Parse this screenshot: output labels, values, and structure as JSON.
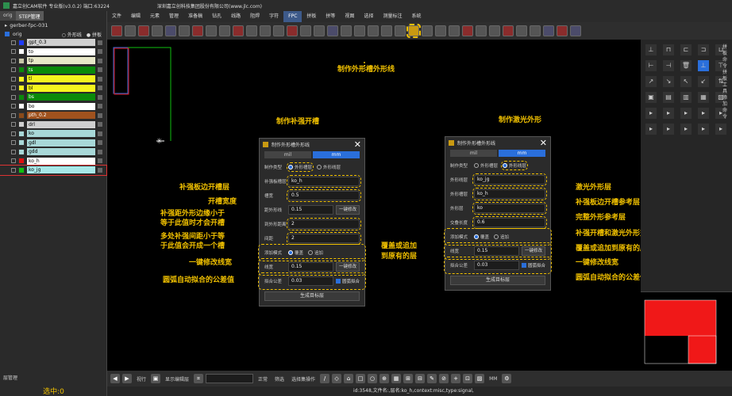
{
  "titlebar": {
    "app_title": "嘉立创CAM软件 专业版(v3.0.2) 端口:63224",
    "company": "深圳嘉立创科技集团股份有限公司(www.jlc.com)"
  },
  "left": {
    "tabs": [
      "orig",
      "STEP管理"
    ],
    "project": "gerber-fpc-031",
    "orig_label": "orig",
    "outline_label": "外形线",
    "flip_label": "拼板",
    "layers": [
      {
        "name": "gpt_0.3",
        "color": "#1e3aff",
        "bg": "#cfcfcf"
      },
      {
        "name": "to",
        "color": "#ffffff",
        "bg": "#ffffff"
      },
      {
        "name": "tp",
        "color": "#c8c8a8",
        "bg": "#e8e8c8"
      },
      {
        "name": "ts",
        "color": "#0a8a0a",
        "bg": "#0a8a0a"
      },
      {
        "name": "tl",
        "color": "#f5f51e",
        "bg": "#f5f51e"
      },
      {
        "name": "bl",
        "color": "#f5f51e",
        "bg": "#f5f51e"
      },
      {
        "name": "bs",
        "color": "#0a8a0a",
        "bg": "#0a8a0a"
      },
      {
        "name": "bo",
        "color": "#ffffff",
        "bg": "#ffffff"
      },
      {
        "name": "pth_0.2",
        "color": "#8a4a1a",
        "bg": "#a0521e"
      },
      {
        "name": "drl",
        "color": "#cfcfcf",
        "bg": "#cfcfcf"
      },
      {
        "name": "ko",
        "color": "#a8d8d8",
        "bg": "#a8d8d8"
      },
      {
        "name": "gdl",
        "color": "#a8d8d8",
        "bg": "#a8d8d8"
      },
      {
        "name": "gdd",
        "color": "#a8d8d8",
        "bg": "#a8d8d8"
      },
      {
        "name": "ko_h",
        "color": "#e01010",
        "bg": "#ffffff"
      },
      {
        "name": "ko_jg",
        "color": "#10c010",
        "bg": "#a8e8e8"
      }
    ],
    "bottom_tab": "层管理",
    "selected": "选中:0"
  },
  "menu": [
    "文件",
    "编辑",
    "元素",
    "管理",
    "准备稿",
    "钻孔",
    "线路",
    "阻焊",
    "字符",
    "FPC",
    "拼板",
    "拼等",
    "视图",
    "选择",
    "测量标注",
    "系统"
  ],
  "menu_active": "FPC",
  "dialog1": {
    "title": "制作外形槽外形线",
    "units": [
      "mil",
      "mm"
    ],
    "type_label": "制作类型",
    "type_opt1": "外形槽层",
    "type_opt2": "外形线层",
    "f1_label": "补强板槽层",
    "f1_value": "ko_h",
    "f2_label": "槽宽",
    "f2_value": "0.5",
    "f3_label": "距外形线",
    "f3_value": "0.15",
    "f3_btn": "一键修改",
    "f4_label": "到外形距离",
    "f4_value": "2",
    "f5_label": "间距",
    "f5_value": "2",
    "mode_label": "添加模式",
    "mode_opt1": "覆盖",
    "mode_opt2": "追加",
    "lw_label": "线宽",
    "lw_value": "0.15",
    "lw_btn": "一键修改",
    "tol_label": "拟合公差",
    "tol_value": "0.03",
    "tol_chk": "圆弧拟合",
    "gen": "生成目标层"
  },
  "dialog2": {
    "title": "制作外形槽外形线",
    "units": [
      "mil",
      "mm"
    ],
    "type_label": "制作类型",
    "type_opt1": "外形槽层",
    "type_opt2": "外形线层",
    "f1_label": "外形线层",
    "f1_value": "ko_jg",
    "f2_label": "外形槽层",
    "f2_value": "ko_h",
    "f3_label": "外形层",
    "f3_value": "ko",
    "f4_label": "交叠长度",
    "f4_value": "0.6",
    "mode_label": "添加模式",
    "mode_opt1": "覆盖",
    "mode_opt2": "追加",
    "lw_label": "线宽",
    "lw_value": "0.15",
    "lw_btn": "一键修改",
    "tol_label": "拟合公差",
    "tol_value": "0.03",
    "tol_chk": "圆弧拟合",
    "gen": "生成目标层"
  },
  "annotations": {
    "top": "制作外形槽外形线",
    "d1_title": "制作补强开槽",
    "d2_title": "制作激光外形",
    "a1": "补强板边开槽层",
    "a2": "开槽宽度",
    "a3a": "补强距外形边缘小于",
    "a3b": "等于此值时才会开槽",
    "a4a": "多处补强间距小于等",
    "a4b": "于此值会开成一个槽",
    "a5": "一键修改线宽",
    "a6": "圆弧自动拟合的公差值",
    "m1a": "覆盖或追加",
    "m1b": "到原有的层",
    "b1": "激光外形层",
    "b2": "补强板边开槽参考层",
    "b3": "完整外形参考层",
    "b4": "补强开槽和激光外形交叠长度",
    "b5": "覆盖或追加到原有的层",
    "b6": "一键修改线宽",
    "b7": "圆弧自动拟合的公差值"
  },
  "right": {
    "labels": "拼板命令 拼板工具 添加命令"
  },
  "status": {
    "mode": "视行",
    "show_btn": "显示编辑层",
    "normal": "正常",
    "checkbox": "筛选",
    "select": "选择集操作",
    "unit": "MM",
    "info": "id:3548,文件名:,层名:ko_h,context:misc,type:signal,"
  }
}
